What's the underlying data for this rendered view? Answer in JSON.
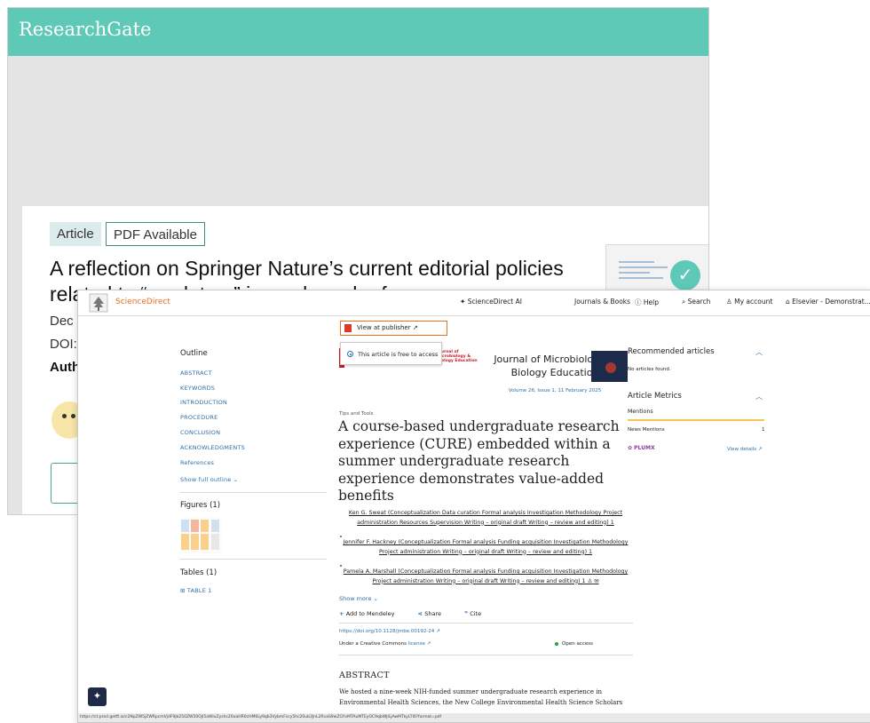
{
  "researchgate": {
    "logo": "ResearchGate",
    "chip_article": "Article",
    "chip_pdf": "PDF Available",
    "title": "A reflection on Springer Nature’s current editorial policies related to “predatory” journals and references",
    "date_partial": "Dec",
    "doi_partial": "DOI:",
    "authors_partial": "Auth",
    "accent": "#5fc9b8"
  },
  "sciencedirect": {
    "brand": "ScienceDirect",
    "brand_color": "#e9711c",
    "nav": {
      "ai": "ScienceDirect AI",
      "journals": "Journals & Books",
      "help": "Help",
      "search": "Search",
      "account": "My account",
      "institution": "Elsevier - Demonstrat..."
    },
    "view_at_publisher": "View at publisher",
    "outline": {
      "heading": "Outline",
      "items": [
        "ABSTRACT",
        "KEYWORDS",
        "INTRODUCTION",
        "PROCEDURE",
        "CONCLUSION",
        "ACKNOWLEDGMENTS",
        "References"
      ],
      "show_full": "Show full outline",
      "figures": "Figures (1)",
      "tables": "Tables (1)",
      "table_item": "TABLE 1"
    },
    "free_access": "This article is free to access",
    "journal_logo_text": "Journal of Microbiology & Biology Education",
    "journal_name": "Journal of Microbiology & Biology Education",
    "volume": "Volume 26, Issue 1, 11 February 2025",
    "tips": "Tips and Tools",
    "title": "A course-based undergraduate research experience (CURE) embedded within a summer undergraduate research experience demonstrates value-added benefits",
    "authors": [
      "Ken G. Sweat (Conceptualization Data curation Formal analysis Investigation Methodology Project administration Resources Supervision Writing – original draft Writing – review and editing) 1",
      "Jennifer F. Hackney (Conceptualization Formal analysis Funding acquisition Investigation Methodology Project administration Writing – original draft Writing – review and editing) 1",
      "Pamela A. Marshall (Conceptualization Formal analysis Funding acquisition Investigation Methodology Project administration Writing – original draft Writing – review and editing) 1"
    ],
    "show_more": "Show more",
    "actions": {
      "mendeley": "Add to Mendeley",
      "share": "Share",
      "cite": "Cite"
    },
    "doi": "https://doi.org/10.1128/jmbe.00192-24",
    "license_prefix": "Under a Creative Commons",
    "license_link": "license",
    "open_access": "Open access",
    "abstract_heading": "ABSTRACT",
    "abstract_text": "We hosted a nine-week NIH-funded summer undergraduate research experience in Environmental Health Sciences, the New College Environmental Health Science Scholars",
    "right": {
      "recommended": "Recommended articles",
      "no_articles": "No articles found.",
      "metrics": "Article Metrics",
      "mentions": "Mentions",
      "news_mentions": "News Mentions",
      "news_count": "1",
      "plumx": "PLUMX",
      "view_details": "View details"
    },
    "status_url": "https://ct.prod.getft.io/c2NpZW5jZWRpcmVjdF9jb250ZW50OjI5aWluZyshc20uaHR0cHM6Ly9qb3VybmFscy5hc20ub3JnL2RvaS9wZGYvMTAuMTEyOC9qbWJlLjAwMTkyLTI0?format=pdf"
  }
}
